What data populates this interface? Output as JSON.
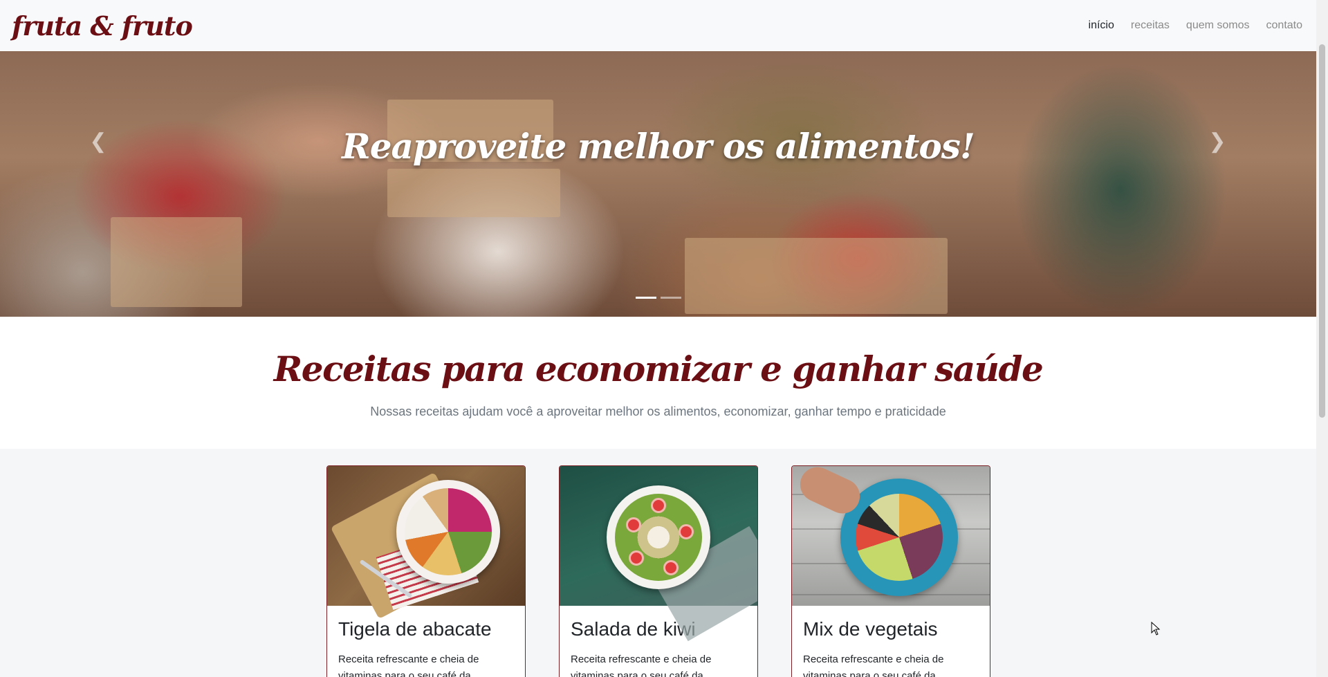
{
  "navbar": {
    "brand": "fruta & fruto",
    "links": [
      "início",
      "receitas",
      "quem somos",
      "contato"
    ]
  },
  "hero": {
    "caption": "Reaproveite melhor os alimentos!",
    "prev_icon": "chevron-left-icon",
    "next_icon": "chevron-right-icon",
    "slides_count": 2,
    "active_slide": 1
  },
  "intro": {
    "title": "Receitas para economizar e ganhar saúde",
    "subtitle": "Nossas receitas ajudam você a aproveitar melhor os alimentos, economizar, ganhar tempo e praticidade"
  },
  "cards": [
    {
      "title": "Tigela de abacate",
      "text": "Receita refrescante e cheia de vitaminas para o seu café da"
    },
    {
      "title": "Salada de kiwi",
      "text": "Receita refrescante e cheia de vitaminas para o seu café da"
    },
    {
      "title": "Mix de vegetais",
      "text": "Receita refrescante e cheia de vitaminas para o seu café da"
    }
  ],
  "colors": {
    "brand": "#6b0f14",
    "card_border": "#7a1f24",
    "muted_text": "#6c757d"
  }
}
